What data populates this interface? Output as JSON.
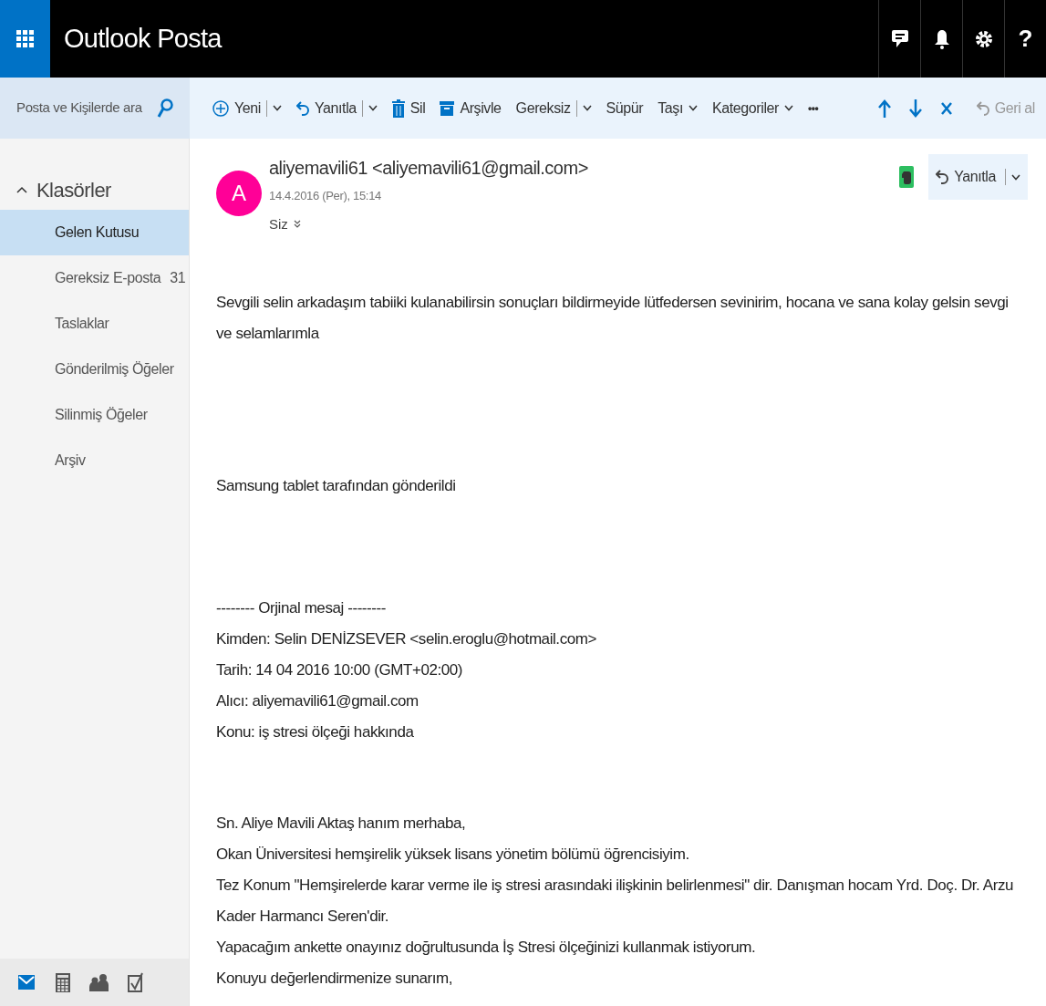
{
  "header": {
    "app_title": "Outlook Posta",
    "help": "?"
  },
  "search": {
    "placeholder": "Posta ve Kişilerde ara"
  },
  "toolbar": [
    {
      "kind": "new",
      "label": "Yeni",
      "caret": true,
      "split": true
    },
    {
      "kind": "reply",
      "label": "Yanıtla",
      "caret": true,
      "split": true
    },
    {
      "kind": "delete",
      "label": "Sil",
      "caret": false,
      "split": false
    },
    {
      "kind": "archive",
      "label": "Arşivle",
      "caret": false,
      "split": false
    },
    {
      "kind": "plain",
      "label": "Gereksiz",
      "caret": true,
      "split": true
    },
    {
      "kind": "plain",
      "label": "Süpür",
      "caret": false,
      "split": false
    },
    {
      "kind": "plain",
      "label": "Taşı",
      "caret": true,
      "split": false
    },
    {
      "kind": "plain",
      "label": "Kategoriler",
      "caret": true,
      "split": false
    },
    {
      "kind": "more",
      "label": "•••",
      "caret": false,
      "split": false
    }
  ],
  "undo": {
    "label": "Geri al",
    "disabled": true
  },
  "folders": {
    "title": "Klasörler",
    "expanded": true,
    "items": [
      {
        "label": "Gelen Kutusu",
        "selected": true
      },
      {
        "label": "Gereksiz E-posta",
        "count": "31",
        "selected": false
      },
      {
        "label": "Taslaklar",
        "selected": false
      },
      {
        "label": "Gönderilmiş Öğeler",
        "selected": false
      },
      {
        "label": "Silinmiş Öğeler",
        "selected": false
      },
      {
        "label": "Arşiv",
        "selected": false
      }
    ]
  },
  "nav": [
    {
      "kind": "mail",
      "selected": true
    },
    {
      "kind": "calendar",
      "selected": false
    },
    {
      "kind": "people",
      "selected": false
    },
    {
      "kind": "tasks",
      "selected": false
    }
  ],
  "message": {
    "avatar": "A",
    "sender": "aliyemavili61 <aliyemavili61@gmail.com>",
    "date": "14.4.2016 (Per), 15:14",
    "to": "Siz",
    "reply": "Yanıtla",
    "blocks": [
      [
        "Sevgili  selin  arkadaşım tabiiki  kulanabilirsin sonuçları  bildirmeyide  lütfedersen  sevinirim, hocana ve sana  kolay gelsin  sevgi ve selamlarımla"
      ],
      [
        "Samsung tablet tarafından gönderildi"
      ],
      [
        "-------- Orjinal mesaj --------",
        "Kimden: Selin DENİZSEVER <selin.eroglu@hotmail.com>",
        "Tarih: 14 04 2016 10:00 (GMT+02:00)",
        "Alıcı: aliyemavili61@gmail.com",
        "Konu: iş stresi ölçeği hakkında"
      ],
      [
        "Sn. Aliye Mavili Aktaş hanım merhaba,",
        "Okan Üniversitesi hemşirelik yüksek lisans yönetim bölümü öğrencisiyim.",
        "Tez Konum \"Hemşirelerde karar verme ile iş stresi arasındaki ilişkinin belirlenmesi\" dir. Danışman hocam Yrd. Doç. Dr. Arzu Kader Harmancı Seren'dir.",
        "Yapacağım ankette onayınız doğrultusunda İş Stresi ölçeğinizi kullanmak istiyorum.",
        "Konuyu değerlendirmenize sunarım,"
      ]
    ]
  }
}
